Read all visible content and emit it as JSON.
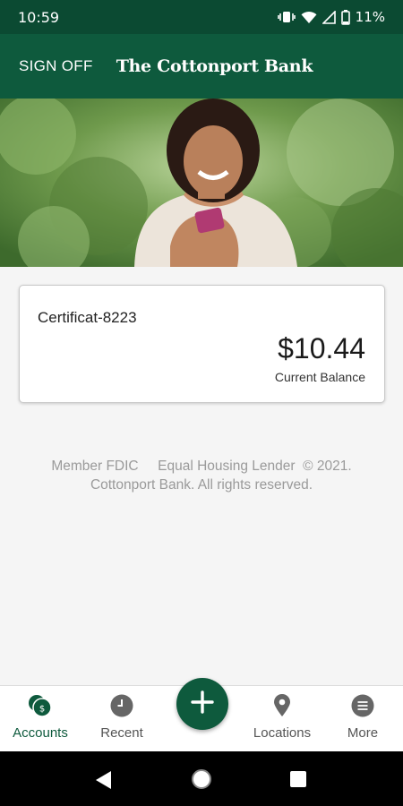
{
  "status_bar": {
    "time": "10:59",
    "battery": "11%"
  },
  "app_bar": {
    "sign_off": "SIGN OFF",
    "brand": "The Cottonport Bank"
  },
  "account": {
    "name": "Certificat-8223",
    "balance": "$10.44",
    "balance_label": "Current Balance"
  },
  "footer": {
    "line1": "Member FDIC     Equal Housing Lender  © 2021.",
    "line2": "Cottonport Bank. All rights reserved."
  },
  "nav": {
    "items": [
      {
        "label": "Accounts",
        "icon": "accounts-icon"
      },
      {
        "label": "Recent",
        "icon": "clock-icon"
      },
      {
        "label": "",
        "icon": "plus-icon"
      },
      {
        "label": "Locations",
        "icon": "location-pin-icon"
      },
      {
        "label": "More",
        "icon": "menu-icon"
      }
    ]
  },
  "colors": {
    "brand_green": "#0e5a3d",
    "status_green": "#0b4a32"
  }
}
